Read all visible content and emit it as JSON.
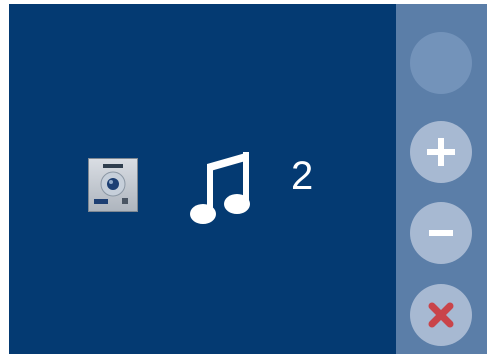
{
  "ringtone_screen": {
    "ringtone_number": "2"
  },
  "icons": {
    "station": "door-entry-panel-icon",
    "ringtone": "music-note-icon",
    "increase": "plus-icon",
    "decrease": "minus-icon",
    "close": "close-icon"
  },
  "colors": {
    "screen_background": "#043a72",
    "sidebar_background": "#5b7ea8",
    "button_background": "#a7b9d2",
    "close_accent": "#c9444a"
  }
}
